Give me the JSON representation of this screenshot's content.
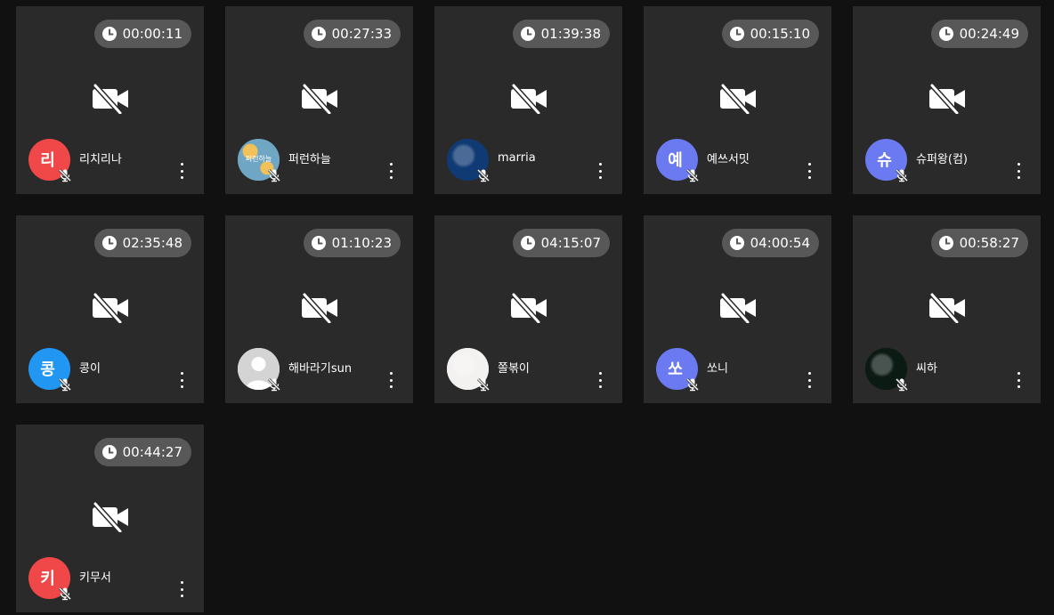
{
  "tiles": [
    {
      "name": "리치리나",
      "timer": "00:00:11",
      "avatar": {
        "type": "initial",
        "initial": "리",
        "color": "#f04848"
      }
    },
    {
      "name": "퍼런하늘",
      "timer": "00:27:33",
      "avatar": {
        "type": "image",
        "image_text": "퍼런하늘",
        "color": "#6fa6c4"
      }
    },
    {
      "name": "marria",
      "timer": "01:39:38",
      "avatar": {
        "type": "image",
        "color": "#0f3a73"
      }
    },
    {
      "name": "예쓰서밋",
      "timer": "00:15:10",
      "avatar": {
        "type": "initial",
        "initial": "예",
        "color": "#6b7af0"
      }
    },
    {
      "name": "슈퍼왕(컴)",
      "timer": "00:24:49",
      "avatar": {
        "type": "initial",
        "initial": "슈",
        "color": "#6b7af0"
      }
    },
    {
      "name": "콩이",
      "timer": "02:35:48",
      "avatar": {
        "type": "initial",
        "initial": "콩",
        "color": "#2196f3"
      }
    },
    {
      "name": "해바라기sun",
      "timer": "01:10:23",
      "avatar": {
        "type": "default-person",
        "color": "#cfcfcf"
      }
    },
    {
      "name": "쫄볶이",
      "timer": "04:15:07",
      "avatar": {
        "type": "image",
        "color": "#f4f1f1"
      }
    },
    {
      "name": "쏘니",
      "timer": "04:00:54",
      "avatar": {
        "type": "initial",
        "initial": "쏘",
        "color": "#6b7af0"
      }
    },
    {
      "name": "씨하",
      "timer": "00:58:27",
      "avatar": {
        "type": "image",
        "color": "#0c1a14"
      }
    },
    {
      "name": "키무서",
      "timer": "00:44:27",
      "avatar": {
        "type": "initial",
        "initial": "키",
        "color": "#f04848"
      }
    }
  ]
}
